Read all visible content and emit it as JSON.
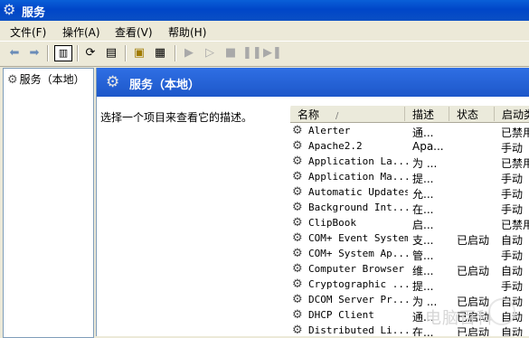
{
  "window": {
    "title": "服务",
    "icon": "gears-icon"
  },
  "menu": [
    "文件(F)",
    "操作(A)",
    "查看(V)",
    "帮助(H)"
  ],
  "toolbar": {
    "buttons": [
      "back-arrow",
      "forward-arrow",
      "show-hide-tree",
      "refresh",
      "export-list",
      "properties",
      "help",
      "start",
      "start-alt",
      "stop",
      "pause",
      "restart"
    ]
  },
  "tree": {
    "root": "服务（本地）"
  },
  "panel": {
    "title": "服务（本地）",
    "description_prompt": "选择一个项目来查看它的描述。"
  },
  "columns": {
    "name": "名称",
    "sort_indicator": "/",
    "description": "描述",
    "status": "状态",
    "startup": "启动类"
  },
  "services": [
    {
      "name": "Alerter",
      "desc": "通...",
      "status": "",
      "startup": "已禁用"
    },
    {
      "name": "Apache2.2",
      "desc": "Apa...",
      "status": "",
      "startup": "手动"
    },
    {
      "name": "Application La...",
      "desc": "为 ...",
      "status": "",
      "startup": "已禁用"
    },
    {
      "name": "Application Ma...",
      "desc": "提...",
      "status": "",
      "startup": "手动"
    },
    {
      "name": "Automatic Updates",
      "desc": "允...",
      "status": "",
      "startup": "手动"
    },
    {
      "name": "Background Int...",
      "desc": "在...",
      "status": "",
      "startup": "手动"
    },
    {
      "name": "ClipBook",
      "desc": "启...",
      "status": "",
      "startup": "已禁用"
    },
    {
      "name": "COM+ Event System",
      "desc": "支...",
      "status": "已启动",
      "startup": "自动"
    },
    {
      "name": "COM+ System Ap...",
      "desc": "管...",
      "status": "",
      "startup": "手动"
    },
    {
      "name": "Computer Browser",
      "desc": "维...",
      "status": "已启动",
      "startup": "自动"
    },
    {
      "name": "Cryptographic ...",
      "desc": "提...",
      "status": "",
      "startup": "手动"
    },
    {
      "name": "DCOM Server Pr...",
      "desc": "为 ...",
      "status": "已启动",
      "startup": "自动"
    },
    {
      "name": "DHCP Client",
      "desc": "通...",
      "status": "已启动",
      "startup": "自动"
    },
    {
      "name": "Distributed Li...",
      "desc": "在...",
      "status": "已启动",
      "startup": "自动"
    }
  ],
  "watermark": {
    "text": "电脑百科"
  }
}
